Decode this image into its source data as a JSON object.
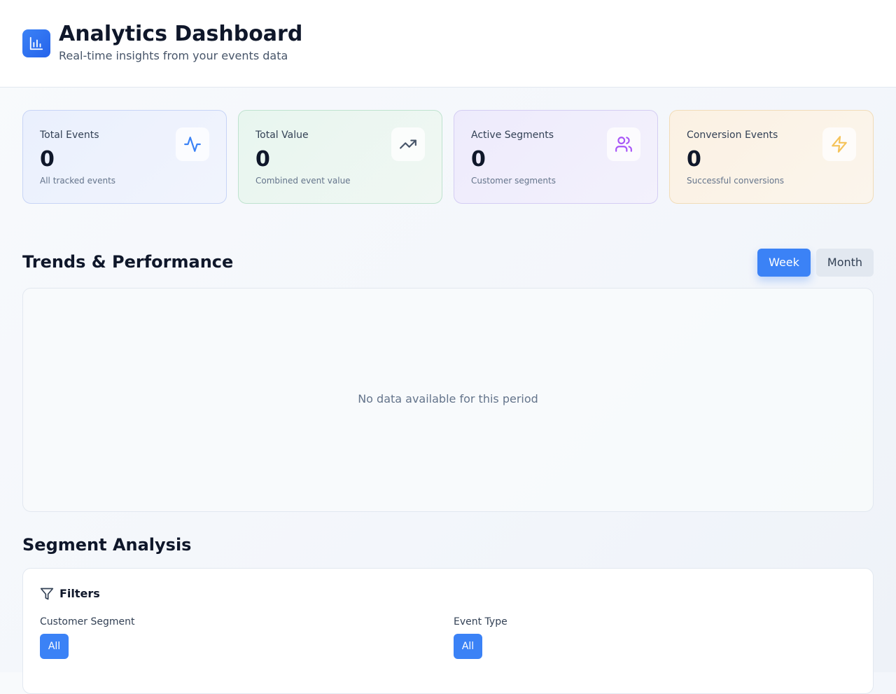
{
  "header": {
    "title": "Analytics Dashboard",
    "subtitle": "Real-time insights from your events data"
  },
  "stats": [
    {
      "label": "Total Events",
      "value": "0",
      "desc": "All tracked events",
      "icon": "activity-icon",
      "color": "#3b82f6"
    },
    {
      "label": "Total Value",
      "value": "0",
      "desc": "Combined event value",
      "icon": "trending-up-icon",
      "color": "#475569"
    },
    {
      "label": "Active Segments",
      "value": "0",
      "desc": "Customer segments",
      "icon": "users-icon",
      "color": "#a855f7"
    },
    {
      "label": "Conversion Events",
      "value": "0",
      "desc": "Successful conversions",
      "icon": "zap-icon",
      "color": "#f5c35a"
    }
  ],
  "trends": {
    "title": "Trends & Performance",
    "week_label": "Week",
    "month_label": "Month",
    "selected": "Week",
    "empty_text": "No data available for this period"
  },
  "segments": {
    "title": "Segment Analysis",
    "filters_title": "Filters",
    "customer_segment_label": "Customer Segment",
    "customer_segment_value": "All",
    "event_type_label": "Event Type",
    "event_type_value": "All"
  },
  "colors": {
    "accent": "#3b82f6",
    "text": "#0f172a"
  }
}
